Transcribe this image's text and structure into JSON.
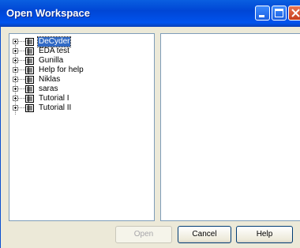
{
  "window": {
    "title": "Open Workspace"
  },
  "tree": {
    "items": [
      {
        "label": "DeCyder",
        "selected": true
      },
      {
        "label": "EDA test",
        "selected": false
      },
      {
        "label": "Gunilla",
        "selected": false
      },
      {
        "label": "Help for help",
        "selected": false
      },
      {
        "label": "Niklas",
        "selected": false
      },
      {
        "label": "saras",
        "selected": false
      },
      {
        "label": "Tutorial I",
        "selected": false
      },
      {
        "label": "Tutorial II",
        "selected": false
      }
    ]
  },
  "buttons": {
    "open": "Open",
    "cancel": "Cancel",
    "help": "Help"
  },
  "colors": {
    "titlebar": "#0053ee",
    "selection": "#316ac5",
    "dialog_bg": "#ece9d8"
  }
}
